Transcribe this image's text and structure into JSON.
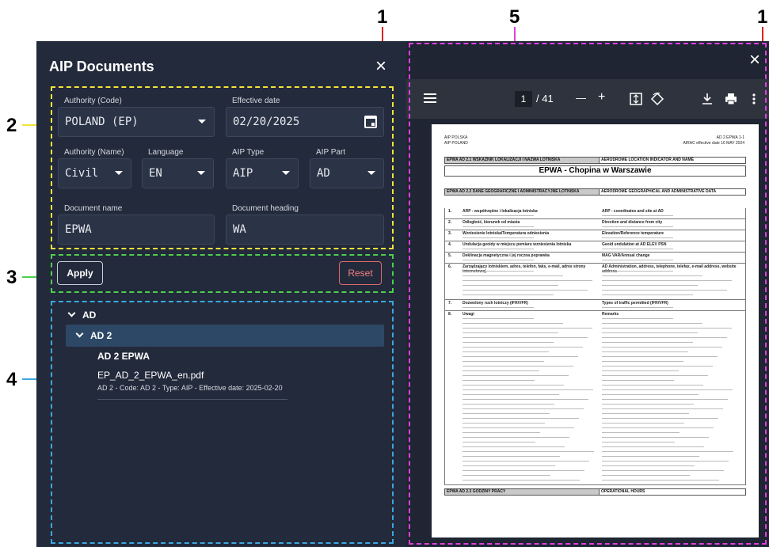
{
  "callouts": [
    "1",
    "2",
    "3",
    "4",
    "5",
    "1"
  ],
  "panel": {
    "title": "AIP Documents",
    "close_glyph": "×",
    "labels": {
      "authority_code": "Authority (Code)",
      "effective_date": "Effective date",
      "authority_name": "Authority (Name)",
      "language": "Language",
      "aip_type": "AIP Type",
      "aip_part": "AIP Part",
      "document_name": "Document name",
      "document_heading": "Document heading"
    },
    "values": {
      "authority_code": "POLAND (EP)",
      "effective_date": "02/20/2025",
      "authority_name": "Civil",
      "language": "EN",
      "aip_type": "AIP",
      "aip_part": "AD",
      "document_name": "EPWA",
      "document_heading": "WA"
    },
    "apply_label": "Apply",
    "reset_label": "Reset",
    "tree": {
      "level1": "AD",
      "level2": "AD 2",
      "level3": "AD 2 EPWA",
      "file": "EP_AD_2_EPWA_en.pdf",
      "meta": "AD 2 - Code: AD 2 - Type: AIP - Effective date: 2025-02-20"
    }
  },
  "viewer": {
    "close_glyph": "×",
    "current_page": "1",
    "total_pages": "/ 41",
    "zoom_out": "—",
    "zoom_in": "+",
    "pdf": {
      "header_left_1": "AIP POLSKA",
      "header_left_2": "AIP POLAND",
      "header_right_1": "AD 2 EPWA 1-1",
      "header_right_2": "AIRAC effective date    16 MAY 2024",
      "sec1_left": "EPWA  AD 2.1   WSKAŹNIK LOKALIZACJI I NAZWA LOTNISKA",
      "sec1_right": "AERODROME LOCATION INDICATOR AND NAME",
      "title": "EPWA - Chopina w Warszawie",
      "sec2_left": "EPWA  AD 2.2   DANE GEOGRAFICZNE I ADMINISTRACYJNE LOTNISKA",
      "sec2_right": "AERODROME GEOGRAPHICAL AND ADMINISTRATIVE DATA",
      "rows": [
        {
          "n": "1.",
          "l": "ARP - współrzędne i lokalizacja lotniska",
          "r": "ARP - coordinates and site at AD"
        },
        {
          "n": "2.",
          "l": "Odległość, kierunek od miasta",
          "r": "Direction and distance from city"
        },
        {
          "n": "3.",
          "l": "Wzniesienie lotniska/Temperatura odniesienia",
          "r": "Elevation/Reference temperature"
        },
        {
          "n": "4.",
          "l": "Undulacja geoidy w miejscu pomiaru wzniesienia lotniska",
          "r": "Geoid undulation at AD ELEV PSN"
        },
        {
          "n": "5.",
          "l": "Deklinacja magnetyczna i jej roczna poprawka",
          "r": "MAG VAR/Annual change"
        },
        {
          "n": "6.",
          "l": "Zarządzający lotniskiem, adres, telefon, faks, e-mail, adres strony internetowej",
          "r": "AD Administration, address, telephone, telefax, e-mail address, website address"
        },
        {
          "n": "7.",
          "l": "Dozwolony ruch lotniczy (IFR/VFR)",
          "r": "Types of traffic permitted (IFR/VFR)"
        },
        {
          "n": "8.",
          "l": "Uwagi",
          "r": "Remarks"
        }
      ],
      "sec3_left": "EPWA  AD 2.3   GODZINY PRACY",
      "sec3_right": "OPERATIONAL HOURS"
    }
  },
  "colors": {
    "panel_bg": "#232a3b",
    "selected_row": "#2d4867",
    "reset": "#f08080",
    "callout_red": "#e02020",
    "callout_yellow": "#f2e33a",
    "callout_green": "#4cd04c",
    "callout_blue": "#3aa7e0",
    "callout_magenta": "#e040e0"
  }
}
